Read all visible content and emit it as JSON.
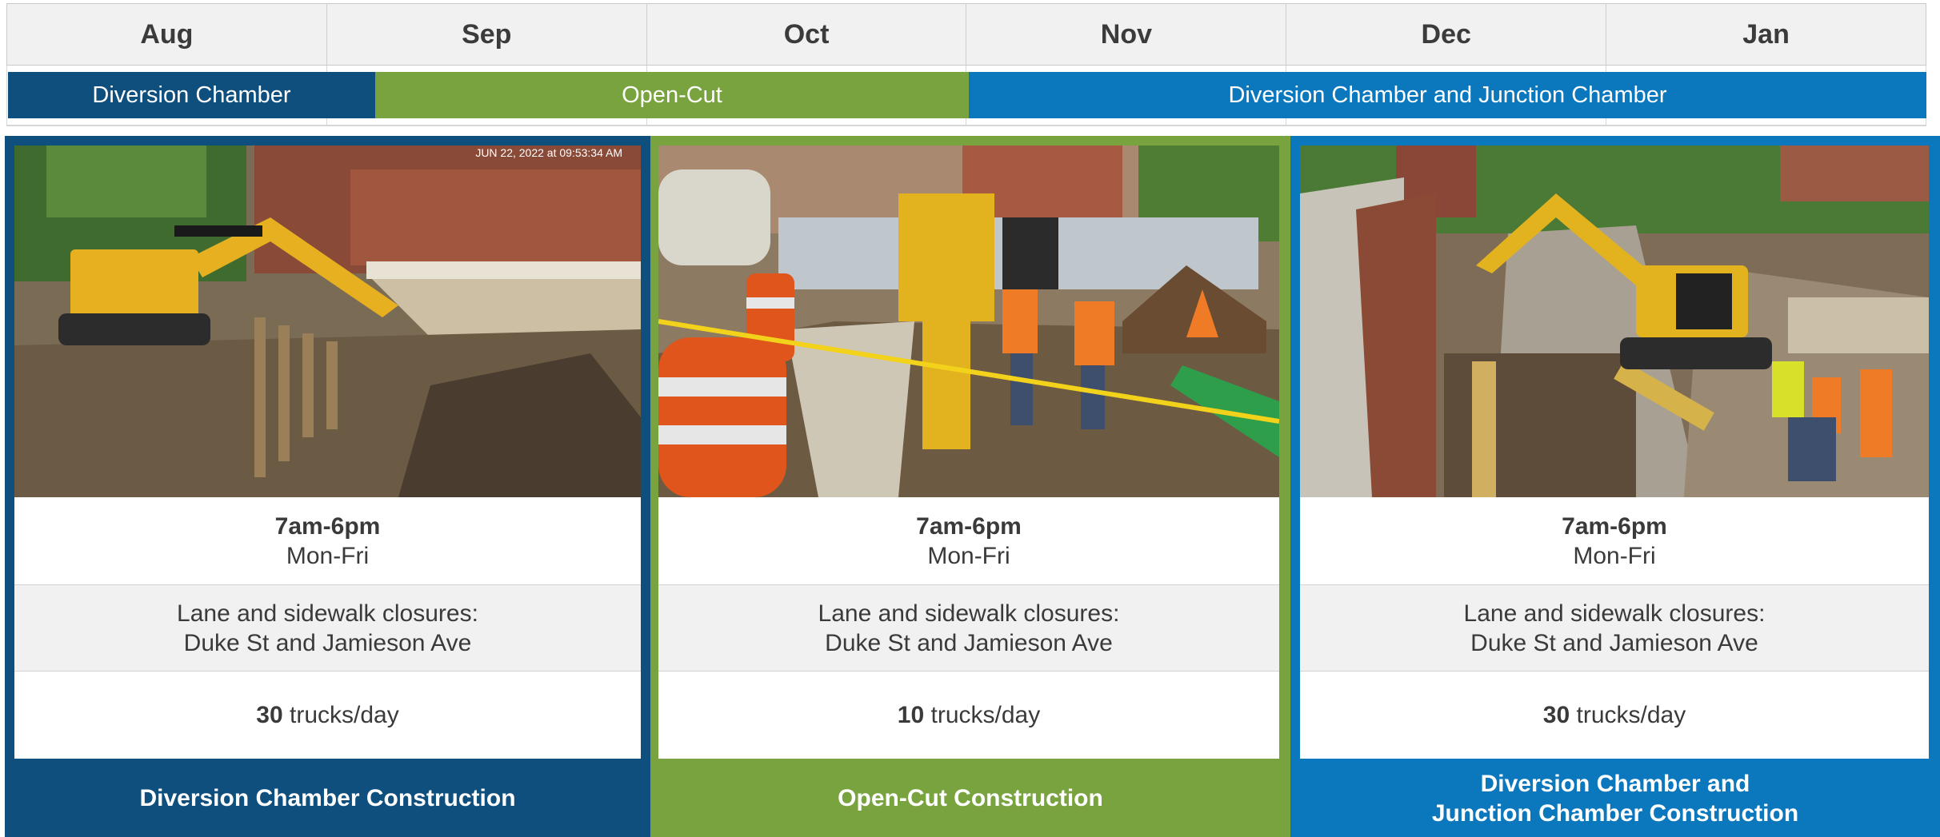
{
  "timeline": {
    "months": [
      "Aug",
      "Sep",
      "Oct",
      "Nov",
      "Dec",
      "Jan"
    ],
    "phases": [
      {
        "label": "Diversion Chamber",
        "color": "#0e4f7e"
      },
      {
        "label": "Open-Cut",
        "color": "#78a33f"
      },
      {
        "label": "Diversion Chamber and Junction Chamber",
        "color": "#0b77bd"
      }
    ]
  },
  "panels": [
    {
      "photo_timestamp": "JUN 22, 2022 at 09:53:34 AM",
      "photo_icon": "excavator-site-photo",
      "hours": "7am-6pm",
      "days": "Mon-Fri",
      "closures_line1": "Lane and sidewalk closures:",
      "closures_line2": "Duke St and Jamieson Ave",
      "trucks_count": "30",
      "trucks_unit": "trucks/day",
      "footer_line1": "Diversion Chamber Construction",
      "footer_line2": "",
      "color": "#0e4f7e"
    },
    {
      "photo_icon": "street-trench-photo",
      "hours": "7am-6pm",
      "days": "Mon-Fri",
      "closures_line1": "Lane and sidewalk closures:",
      "closures_line2": "Duke St and Jamieson Ave",
      "trucks_count": "10",
      "trucks_unit": "trucks/day",
      "footer_line1": "Open-Cut Construction",
      "footer_line2": "",
      "color": "#78a33f"
    },
    {
      "photo_icon": "chamber-excavation-photo",
      "hours": "7am-6pm",
      "days": "Mon-Fri",
      "closures_line1": "Lane and sidewalk closures:",
      "closures_line2": "Duke St and Jamieson Ave",
      "trucks_count": "30",
      "trucks_unit": "trucks/day",
      "footer_line1": "Diversion Chamber and",
      "footer_line2": "Junction Chamber Construction",
      "color": "#0b77bd"
    }
  ]
}
